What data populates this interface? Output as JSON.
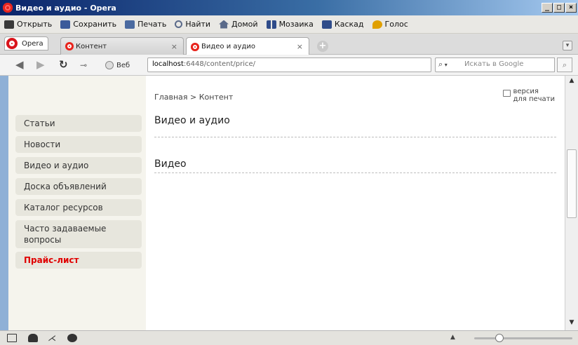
{
  "window": {
    "title": "Видео и аудио - Opera"
  },
  "window_buttons": [
    "_",
    "□",
    "×"
  ],
  "toolbar": [
    {
      "label": "Открыть",
      "icon": "folder-icon",
      "color": "#3a3a3a"
    },
    {
      "label": "Сохранить",
      "icon": "save-icon",
      "color": "#3b5a9a"
    },
    {
      "label": "Печать",
      "icon": "print-icon",
      "color": "#4a6aa0"
    },
    {
      "label": "Найти",
      "icon": "search-icon",
      "color": "#5a6a8a"
    },
    {
      "label": "Домой",
      "icon": "home-icon",
      "color": "#5a6a8a"
    },
    {
      "label": "Мозаика",
      "icon": "tile-icon",
      "color": "#2f4c8a"
    },
    {
      "label": "Каскад",
      "icon": "cascade-icon",
      "color": "#2f4c8a"
    },
    {
      "label": "Голос",
      "icon": "voice-icon",
      "color": "#e0a000"
    }
  ],
  "menu_button": {
    "label": "Opera",
    "icon": "opera-logo-icon"
  },
  "tabs": [
    {
      "label": "Контент",
      "active": false,
      "close": "×"
    },
    {
      "label": "Видео и аудио",
      "active": true,
      "close": "×"
    }
  ],
  "address": {
    "site_label": "Веб",
    "url_host": "localhost",
    "url_rest": ":6448/content/price/",
    "search_placeholder": "Искать в Google"
  },
  "breadcrumb": "Главная > Контент",
  "print_link": {
    "line1": "версия",
    "line2": "для печати"
  },
  "page": {
    "heading": "Видео и аудио",
    "section": "Видео"
  },
  "sidebar": [
    {
      "label": "Статьи",
      "active": false
    },
    {
      "label": "Новости",
      "active": false
    },
    {
      "label": "Видео и аудио",
      "active": false
    },
    {
      "label": "Доска объявлений",
      "active": false
    },
    {
      "label": "Каталог ресурсов",
      "active": false
    },
    {
      "label": "Часто задаваемые вопросы",
      "active": false
    },
    {
      "label": "Прайс-лист",
      "active": true
    }
  ],
  "colors": {
    "active_link": "#e00000",
    "sidebar_bg": "#f5f4ed",
    "sidebar_item_bg": "#e7e6dd",
    "left_edge": "#8fb0d6"
  }
}
